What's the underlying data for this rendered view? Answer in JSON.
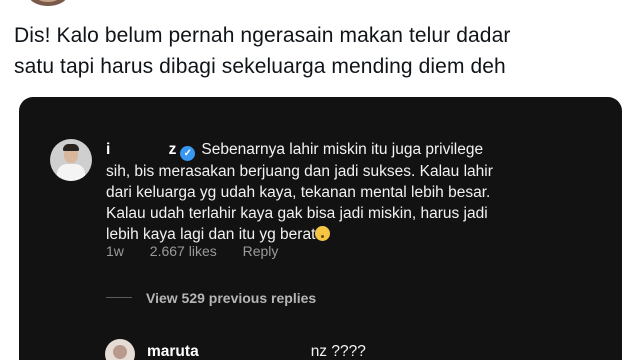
{
  "tweet": {
    "line1": "Dis! Kalo belum pernah ngerasain makan telur dadar",
    "line2": "satu tapi harus dibagi sekeluarga mending diem deh"
  },
  "comment": {
    "username_prefix": "i",
    "username_suffix": "z",
    "line1": "Sebenarnya lahir miskin itu juga privilege",
    "line2": "sih, bis merasakan berjuang dan jadi sukses. Kalau lahir",
    "line3": "dari keluarga yg udah kaya, tekanan mental lebih besar.",
    "line4": "Kalau udah terlahir kaya gak bisa jadi miskin, harus jadi",
    "line5": "lebih kaya lagi dan itu yg berat",
    "emoji": "crying-face-emoji",
    "age": "1w",
    "likes": "2.667 likes",
    "reply_label": "Reply"
  },
  "thread": {
    "view_replies": "View 529 previous replies"
  },
  "reply": {
    "username": "maruta",
    "text": "nz ????"
  },
  "colors": {
    "screenshot_bg": "#121212",
    "verified": "#3897f0",
    "meta": "#9a9a9a"
  }
}
